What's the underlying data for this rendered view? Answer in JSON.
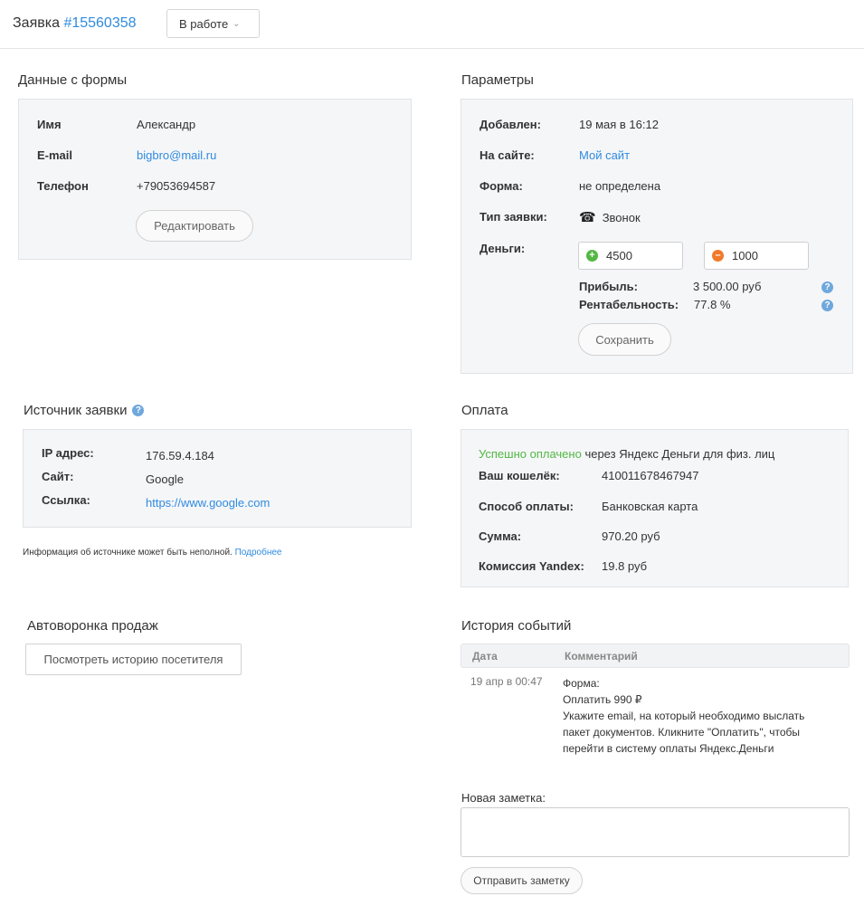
{
  "header": {
    "title_prefix": "Заявка",
    "order_number": "#15560358",
    "status": "В работе"
  },
  "form_data": {
    "title": "Данные с формы",
    "name_label": "Имя",
    "name_value": "Александр",
    "email_label": "E-mail",
    "email_value": "bigbro@mail.ru",
    "phone_label": "Телефон",
    "phone_value": "+79053694587",
    "edit_button": "Редактировать"
  },
  "params": {
    "title": "Параметры",
    "added_label": "Добавлен:",
    "added_value": "19 мая в 16:12",
    "site_label": "На сайте:",
    "site_value": "Мой сайт",
    "form_label": "Форма:",
    "form_value": "не определена",
    "type_label": "Тип заявки:",
    "type_icon": "phone-icon",
    "type_value": "Звонок",
    "money_label": "Деньги:",
    "income_value": "4500",
    "expense_value": "1000",
    "profit_label": "Прибыль:",
    "profit_value": "3 500.00 руб",
    "profitability_label": "Рентабельность:",
    "profitability_value": "77.8 %",
    "save_button": "Сохранить"
  },
  "source": {
    "title": "Источник заявки",
    "ip_label": "IP адрес:",
    "ip_value": "176.59.4.184",
    "site_label": "Сайт:",
    "site_value": "Google",
    "link_label": "Ссылка:",
    "link_value": "https://www.google.com",
    "note_text": "Информация об источнике может быть неполной.",
    "note_link": "Подробнее"
  },
  "payment": {
    "title": "Оплата",
    "status_success": "Успешно оплачено",
    "status_rest": " через Яндекс Деньги для физ. лиц",
    "wallet_label": "Ваш кошелёк:",
    "wallet_value": "410011678467947",
    "method_label": "Способ оплаты:",
    "method_value": "Банковская карта",
    "sum_label": "Сумма:",
    "sum_value": "970.20 руб",
    "fee_label": "Комиссия Yandex:",
    "fee_value": "19.8 руб"
  },
  "funnel": {
    "title": "Автоворонка продаж",
    "history_button": "Посмотреть историю посетителя"
  },
  "history": {
    "title": "История событий",
    "col_date": "Дата",
    "col_comment": "Комментарий",
    "rows": [
      {
        "date": "19 апр в 00:47",
        "lines": [
          "Форма:",
          "Оплатить 990 ₽",
          "Укажите email, на который необходимо выслать",
          "пакет документов. Кликните \"Оплатить\", чтобы",
          "перейти в систему оплаты Яндекс.Деньги"
        ]
      }
    ]
  },
  "note": {
    "label": "Новая заметка:",
    "placeholder": "",
    "send_button": "Отправить заметку"
  },
  "colors": {
    "link": "#2f8be0",
    "success": "#52b844",
    "minus": "#f07a2a",
    "panel_bg": "#f5f6f8"
  }
}
